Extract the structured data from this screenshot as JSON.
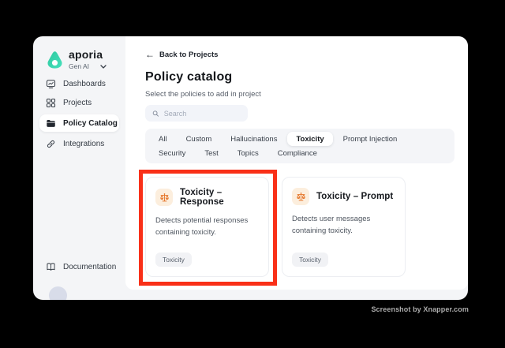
{
  "sidebar": {
    "brand": "aporia",
    "workspace": "Gen AI",
    "items": [
      {
        "label": "Dashboards",
        "active": false
      },
      {
        "label": "Projects",
        "active": false
      },
      {
        "label": "Policy Catalog",
        "active": true
      },
      {
        "label": "Integrations",
        "active": false
      }
    ],
    "footer_item": {
      "label": "Documentation"
    }
  },
  "main": {
    "back_link": "Back to Projects",
    "title": "Policy catalog",
    "subtitle": "Select the policies to add in project",
    "search": {
      "placeholder": "Search"
    },
    "tabs": [
      {
        "label": "All",
        "active": false
      },
      {
        "label": "Custom",
        "active": false
      },
      {
        "label": "Hallucinations",
        "active": false
      },
      {
        "label": "Toxicity",
        "active": true
      },
      {
        "label": "Prompt Injection",
        "active": false
      },
      {
        "label": "Security",
        "active": false
      },
      {
        "label": "Test",
        "active": false
      },
      {
        "label": "Topics",
        "active": false
      },
      {
        "label": "Compliance",
        "active": false
      }
    ],
    "cards": [
      {
        "title": "Toxicity – Response",
        "description": "Detects potential responses containing toxicity.",
        "tag": "Toxicity",
        "highlighted": true
      },
      {
        "title": "Toxicity – Prompt",
        "description": "Detects user messages containing toxicity.",
        "tag": "Toxicity",
        "highlighted": false
      }
    ]
  },
  "watermark": "Screenshot by Xnapper.com",
  "colors": {
    "brand_teal": "#35D6AC",
    "policy_icon_orange": "#E5762A",
    "policy_icon_bg": "#FCEEDD",
    "highlight_red": "#F93018",
    "window_bg": "#F4F5F7",
    "panel_bg": "#FFFFFF"
  }
}
